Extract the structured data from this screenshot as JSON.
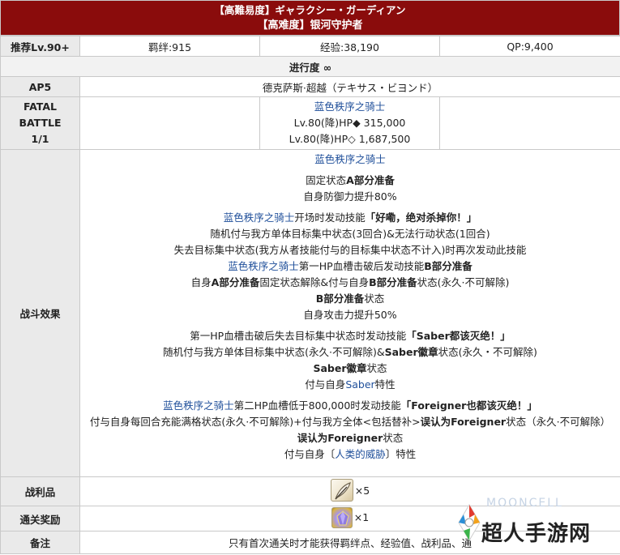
{
  "header": {
    "title_jp": "【高難易度】ギャラクシー・ガーディアン",
    "title_cn": "【高难度】银河守护者"
  },
  "summary": {
    "level_label": "推荐Lv.90+",
    "bond": "羁绊:915",
    "exp": "经验:38,190",
    "qp": "QP:9,400"
  },
  "progress": {
    "label": "进行度 ∞"
  },
  "ap": {
    "label": "AP5",
    "location": "德克萨斯·超越（テキサス・ビヨンド）"
  },
  "fatal": {
    "label_line1": "FATAL",
    "label_line2": "BATTLE",
    "label_line3": "1/1",
    "enemy_name": "蓝色秩序之骑士",
    "hp1": "Lv.80(降)HP◆ 315,000",
    "hp2": "Lv.80(降)HP◇ 1,687,500"
  },
  "effects": {
    "label": "战斗效果",
    "name": "蓝色秩序之骑士",
    "s1_a": "固定状态",
    "s1_b": "A部分准备",
    "s1_line2": "自身防御力提升80%",
    "s2_name": "蓝色秩序之骑士",
    "s2_a": "开场时发动技能",
    "s2_b": "「好嘞，绝对杀掉你！」",
    "s2_line2": "随机付与我方单体目标集中状态(3回合)&无法行动状态(1回合)",
    "s2_line3": "失去目标集中状态(我方从者技能付与的目标集中状态不计入)时再次发动此技能",
    "s3_name": "蓝色秩序之骑士",
    "s3_a": "第一HP血槽击破后发动技能",
    "s3_b": "B部分准备",
    "s3_l2_a": "自身",
    "s3_l2_b": "A部分准备",
    "s3_l2_c": "固定状态解除&付与自身",
    "s3_l2_d": "B部分准备",
    "s3_l2_e": "状态(永久·不可解除)",
    "s3_l3_a": "B部分准备",
    "s3_l3_b": "状态",
    "s3_l4": "自身攻击力提升50%",
    "s4_a": "第一HP血槽击破后失去目标集中状态时发动技能",
    "s4_b": "「Saber都该灭绝！」",
    "s4_l2_a": "随机付与我方单体目标集中状态(永久·不可解除)&",
    "s4_l2_b": "Saber徽章",
    "s4_l2_c": "状态(永久・不可解除)",
    "s4_l3_a": "Saber徽章",
    "s4_l3_b": "状态",
    "s4_l4_a": "付与自身",
    "s4_l4_b": "Saber",
    "s4_l4_c": "特性",
    "s5_name": "蓝色秩序之骑士",
    "s5_a": "第二HP血槽低于800,000时发动技能",
    "s5_b": "「Foreigner也都该灭绝！」",
    "s5_l2_a": "付与自身每回合充能满格状态(永久·不可解除)+付与我方全体<包括替补>",
    "s5_l2_b": "误认为Foreigner",
    "s5_l2_c": "状态（永久·不可解除）",
    "s5_l3_a": "误认为Foreigner",
    "s5_l3_b": "状态",
    "s5_l4_a": "付与自身〔",
    "s5_l4_b": "人类的威胁",
    "s5_l4_c": "〕特性"
  },
  "drops": {
    "label": "战利品",
    "icon": "feather-icon",
    "count": "×5"
  },
  "reward": {
    "label": "通关奖励",
    "icon": "gem-icon",
    "count": "×1"
  },
  "notes": {
    "label": "备注",
    "text": "只有首次通关时才能获得羁绊点、经验值、战利品、通"
  },
  "watermark": {
    "faint": "MOONCELL",
    "text": "超人手游网"
  },
  "colors": {
    "header_bg": "#8a0c0c",
    "label_bg": "#eaeaea",
    "link": "#1f4f9a",
    "border": "#c9c9c9"
  }
}
